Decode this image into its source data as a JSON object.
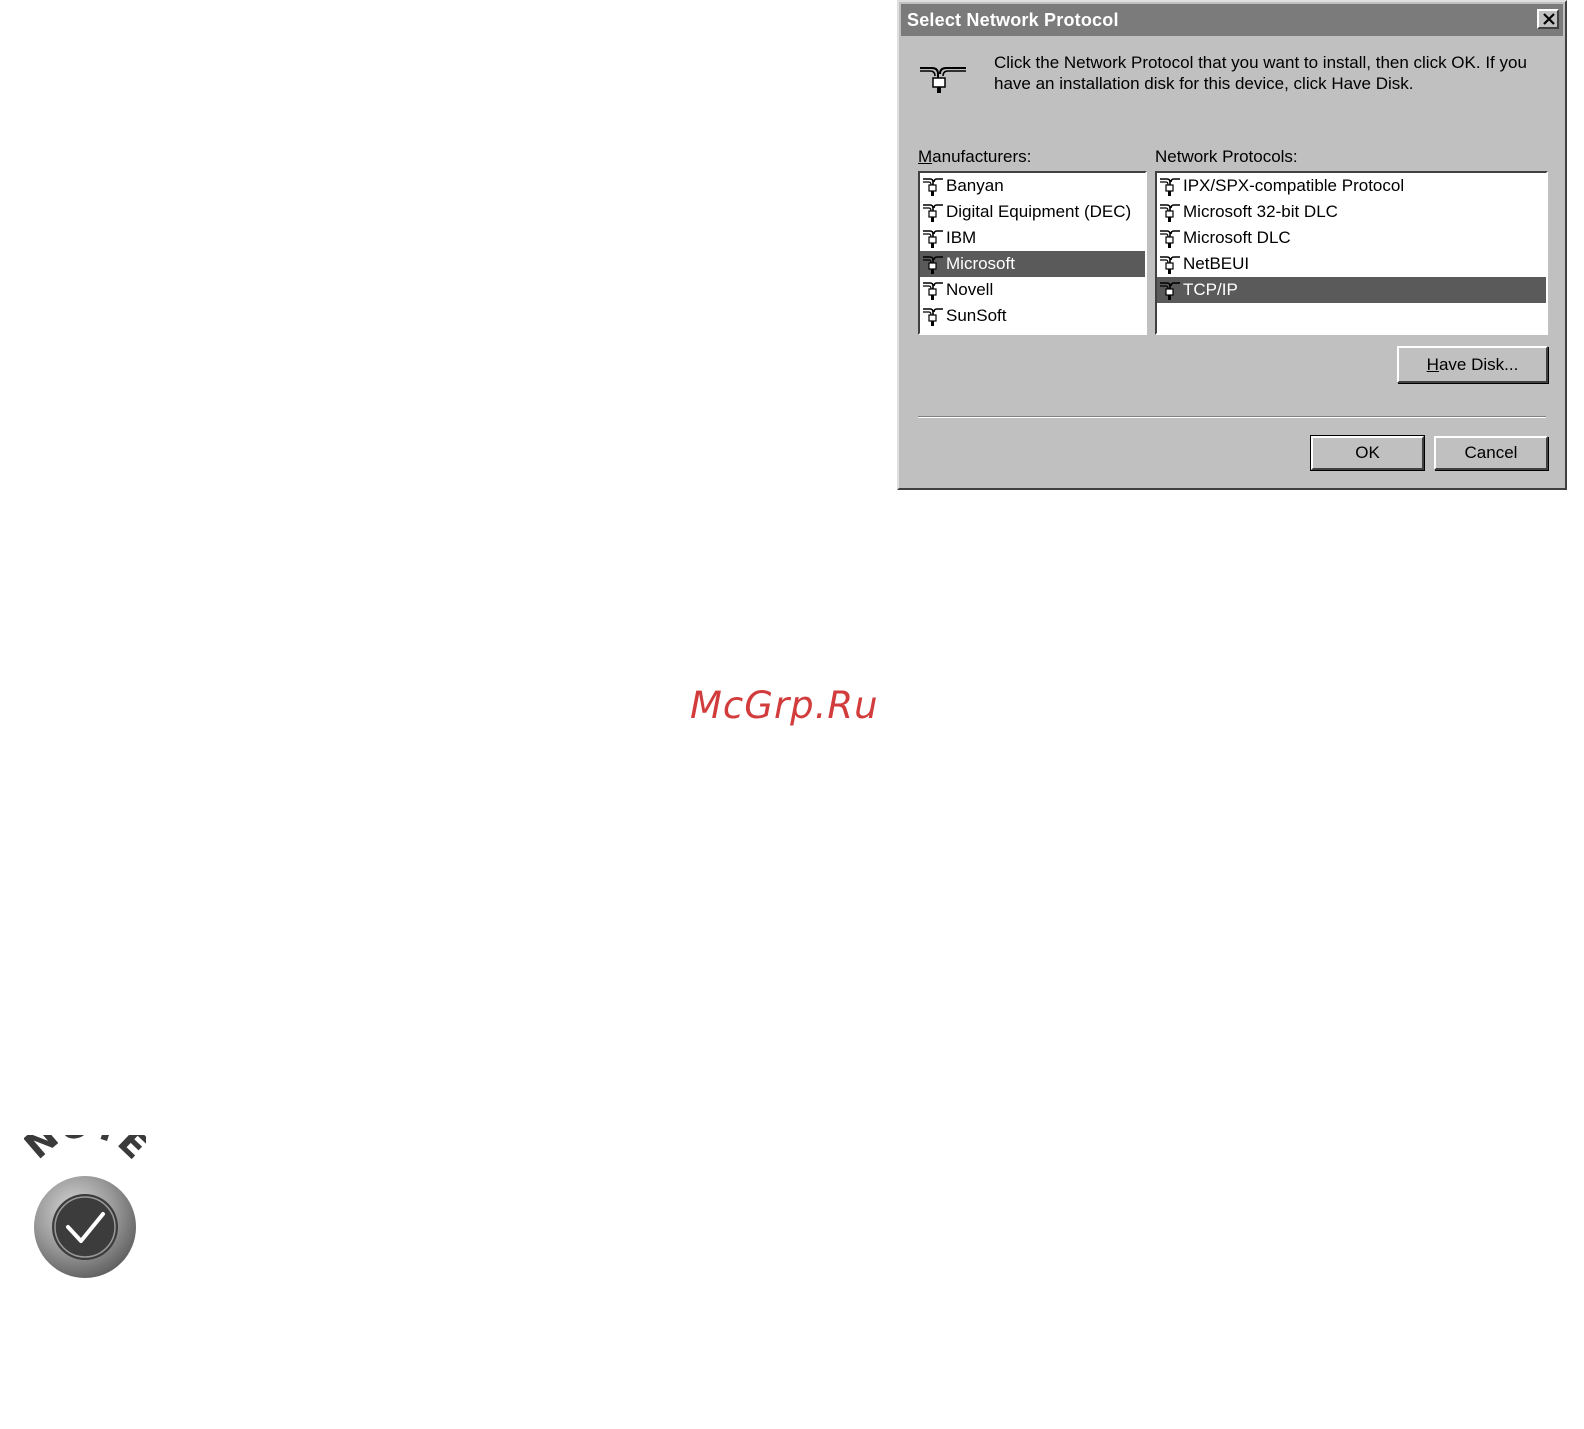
{
  "dialog": {
    "title": "Select Network Protocol",
    "close_label": "✕",
    "instruction": "Click the Network Protocol that you want to install, then click OK. If you have an installation disk for this device, click Have Disk.",
    "manufacturers": {
      "label_accel": "M",
      "label_rest": "anufacturers:",
      "items": [
        {
          "label": "Banyan",
          "selected": false
        },
        {
          "label": "Digital Equipment (DEC)",
          "selected": false
        },
        {
          "label": "IBM",
          "selected": false
        },
        {
          "label": "Microsoft",
          "selected": true
        },
        {
          "label": "Novell",
          "selected": false
        },
        {
          "label": "SunSoft",
          "selected": false
        }
      ]
    },
    "protocols": {
      "label": "Network Protocols:",
      "items": [
        {
          "label": "IPX/SPX-compatible Protocol",
          "selected": false
        },
        {
          "label": "Microsoft 32-bit DLC",
          "selected": false
        },
        {
          "label": "Microsoft DLC",
          "selected": false
        },
        {
          "label": "NetBEUI",
          "selected": false
        },
        {
          "label": "TCP/IP",
          "selected": true
        }
      ]
    },
    "have_disk": {
      "accel": "H",
      "rest": "ave Disk..."
    },
    "ok_label": "OK",
    "cancel_label": "Cancel"
  },
  "watermark": "McGrp.Ru",
  "note_badge": {
    "text": "NOTE",
    "icon": "checkmark-icon"
  },
  "colors": {
    "dialog_face": "#c0c0c0",
    "titlebar": "#7b7b7b",
    "selection": "#5a5a5a",
    "watermark": "#d23c3c"
  }
}
